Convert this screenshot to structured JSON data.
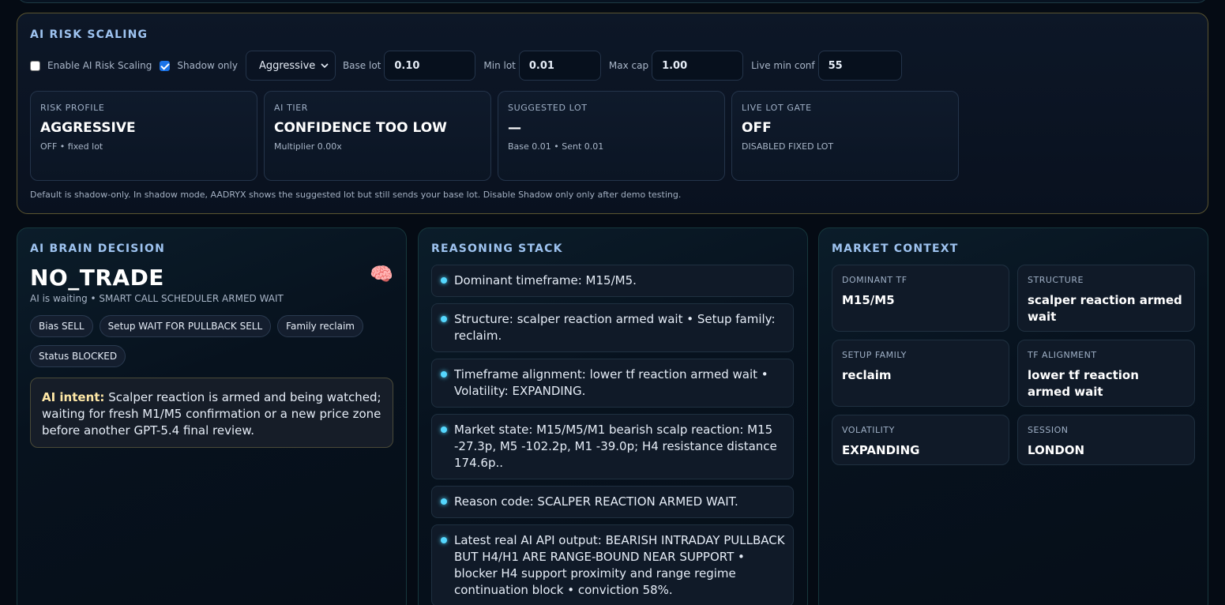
{
  "risk_scaling": {
    "title": "AI RISK SCALING",
    "enable_label": "Enable AI Risk Scaling",
    "enable_checked": false,
    "shadow_label": "Shadow only",
    "shadow_checked": true,
    "profile_select": "Aggressive",
    "base_lot_label": "Base lot",
    "base_lot": "0.10",
    "min_lot_label": "Min lot",
    "min_lot": "0.01",
    "max_cap_label": "Max cap",
    "max_cap": "1.00",
    "live_min_conf_label": "Live min conf",
    "live_min_conf": "55",
    "cards": [
      {
        "label": "RISK PROFILE",
        "value": "AGGRESSIVE",
        "sub": "OFF • fixed lot"
      },
      {
        "label": "AI TIER",
        "value": "CONFIDENCE TOO LOW",
        "sub": "Multiplier 0.00x"
      },
      {
        "label": "SUGGESTED LOT",
        "value": "—",
        "sub": "Base 0.01 • Sent 0.01"
      },
      {
        "label": "LIVE LOT GATE",
        "value": "OFF",
        "sub": "DISABLED FIXED LOT"
      }
    ],
    "footnote": "Default is shadow-only. In shadow mode, AADRYX shows the suggested lot but still sends your base lot. Disable Shadow only only after demo testing."
  },
  "brain": {
    "title": "AI BRAIN DECISION",
    "decision": "NO_TRADE",
    "brain_icon": "🧠",
    "subtitle": "AI is waiting • SMART CALL SCHEDULER ARMED WAIT",
    "chips": [
      "Bias SELL",
      "Setup WAIT FOR PULLBACK SELL",
      "Family reclaim",
      "Status BLOCKED"
    ],
    "intent_label": "AI intent:",
    "intent_text": "Scalper reaction is armed and being watched; waiting for fresh M1/M5 confirmation or a new price zone before another GPT-5.4 final review."
  },
  "reasoning": {
    "title": "REASONING STACK",
    "items": [
      "Dominant timeframe: M15/M5.",
      "Structure: scalper reaction armed wait • Setup family: reclaim.",
      "Timeframe alignment: lower tf reaction armed wait • Volatility: EXPANDING.",
      "Market state: M15/M5/M1 bearish scalp reaction: M15 -27.3p, M5 -102.2p, M1 -39.0p; H4 resistance distance 174.6p..",
      "Reason code: SCALPER REACTION ARMED WAIT.",
      "Latest real AI API output: BEARISH INTRADAY PULLBACK BUT H4/H1 ARE RANGE-BOUND NEAR SUPPORT • blocker H4 support proximity and range regime continuation block • conviction 58%."
    ]
  },
  "market": {
    "title": "MARKET CONTEXT",
    "cells": [
      {
        "label": "DOMINANT TF",
        "value": "M15/M5"
      },
      {
        "label": "STRUCTURE",
        "value": "scalper reaction armed wait"
      },
      {
        "label": "SETUP FAMILY",
        "value": "reclaim"
      },
      {
        "label": "TF ALIGNMENT",
        "value": "lower tf reaction armed wait"
      },
      {
        "label": "VOLATILITY",
        "value": "EXPANDING"
      },
      {
        "label": "SESSION",
        "value": "LONDON"
      }
    ]
  }
}
